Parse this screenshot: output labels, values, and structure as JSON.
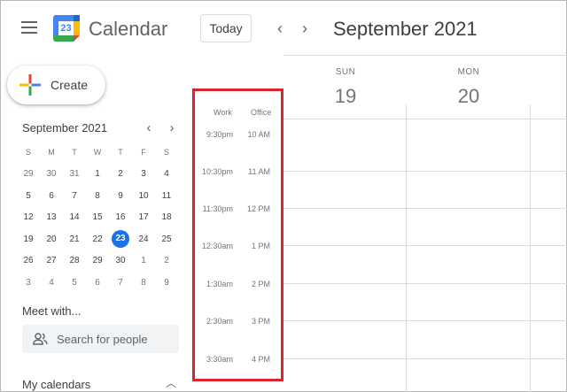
{
  "header": {
    "menu_icon": "hamburger-menu-icon",
    "logo_number": "23",
    "app_title": "Calendar",
    "today_label": "Today",
    "prev_icon": "chevron-left-icon",
    "next_icon": "chevron-right-icon",
    "current_period": "September 2021"
  },
  "create": {
    "label": "Create",
    "icon": "plus-icon"
  },
  "mini_calendar": {
    "title": "September 2021",
    "weekday_headers": [
      "S",
      "M",
      "T",
      "W",
      "T",
      "F",
      "S"
    ],
    "weeks": [
      [
        "29",
        "30",
        "31",
        "1",
        "2",
        "3",
        "4"
      ],
      [
        "5",
        "6",
        "7",
        "8",
        "9",
        "10",
        "11"
      ],
      [
        "12",
        "13",
        "14",
        "15",
        "16",
        "17",
        "18"
      ],
      [
        "19",
        "20",
        "21",
        "22",
        "23",
        "24",
        "25"
      ],
      [
        "26",
        "27",
        "28",
        "29",
        "30",
        "1",
        "2"
      ],
      [
        "3",
        "4",
        "5",
        "6",
        "7",
        "8",
        "9"
      ]
    ],
    "today": "23"
  },
  "meet_with": {
    "title": "Meet with...",
    "search_placeholder": "Search for people",
    "icon": "people-icon"
  },
  "my_calendars": {
    "title": "My calendars",
    "icon": "chevron-up-icon"
  },
  "days": [
    {
      "dow": "SUN",
      "date": "19"
    },
    {
      "dow": "MON",
      "date": "20"
    }
  ],
  "time_zones": {
    "labels": [
      "Work",
      "Office"
    ],
    "rows": [
      {
        "work": "9:30pm",
        "office": "10 AM"
      },
      {
        "work": "10:30pm",
        "office": "11 AM"
      },
      {
        "work": "11:30pm",
        "office": "12 PM"
      },
      {
        "work": "12:30am",
        "office": "1 PM"
      },
      {
        "work": "1:30am",
        "office": "2 PM"
      },
      {
        "work": "2:30am",
        "office": "3 PM"
      },
      {
        "work": "3:30am",
        "office": "4 PM"
      }
    ]
  },
  "colors": {
    "accent": "#1a73e8",
    "highlight": "#d9252b",
    "grid": "#dadce0"
  }
}
